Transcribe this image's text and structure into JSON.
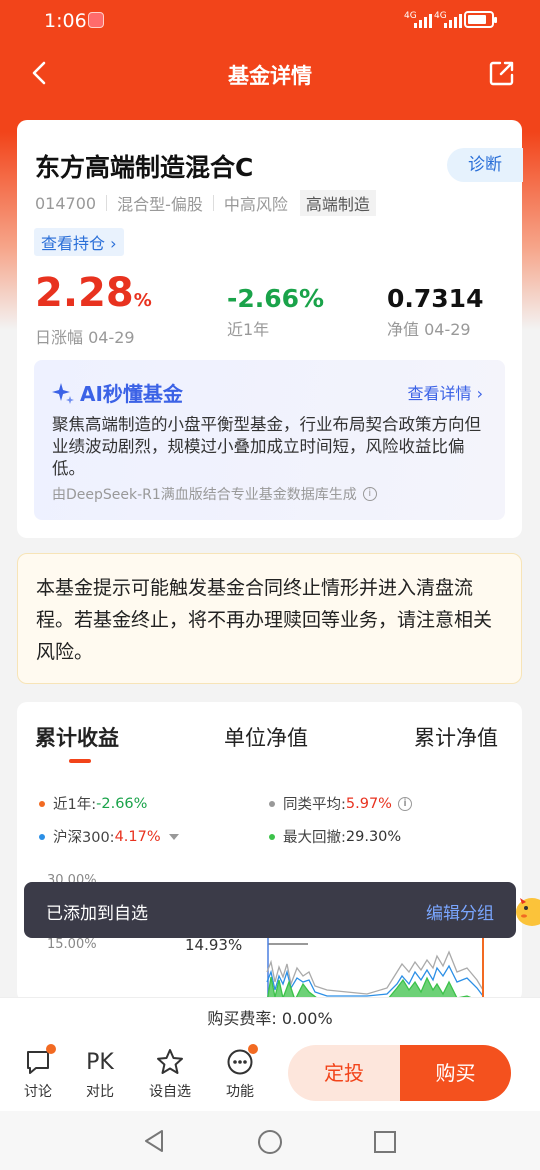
{
  "status": {
    "time": "1:06",
    "net1": "4G",
    "net2": "4G"
  },
  "nav": {
    "title": "基金详情"
  },
  "fund": {
    "name": "东方高端制造混合C",
    "code": "014700",
    "type": "混合型-偏股",
    "risk": "中高风险",
    "theme": "高端制造",
    "diagnose": "诊断",
    "holdings": "查看持仓 ›",
    "daily_change": "2.28",
    "daily_unit": "%",
    "daily_label": "日涨幅 04-29",
    "year_return": "-2.66%",
    "year_label": "近1年",
    "nav_value": "0.7314",
    "nav_label": "净值 04-29"
  },
  "ai": {
    "title": "AI秒懂基金",
    "more": "查看详情 ›",
    "text": "聚焦高端制造的小盘平衡型基金，行业布局契合政策方向但业绩波动剧烈，规模过小叠加成立时间短，风险收益比偏低。",
    "source": "由DeepSeek-R1满血版结合专业基金数据库生成"
  },
  "warning": "本基金提示可能触发基金合同终止情形并进入清盘流程。若基金终止，将不再办理赎回等业务，请注意相关风险。",
  "chart": {
    "tabs": [
      "累计收益",
      "单位净值",
      "累计净值"
    ],
    "legend": [
      {
        "label": "近1年:",
        "value": "-2.66%",
        "color": "#f26a22",
        "value_color": "#1aa34a"
      },
      {
        "label": "同类平均:",
        "value": "5.97%",
        "color": "#999999",
        "value_color": "#e8321f"
      },
      {
        "label": "沪深300:",
        "value": "4.17%",
        "color": "#2b8fe6",
        "value_color": "#e8321f"
      },
      {
        "label": "最大回撤:",
        "value": "29.30%",
        "color": "#3cc24a",
        "value_color": "#333333"
      }
    ],
    "ytick_top": "30.00%",
    "ytick_mid": "15.00%",
    "peak_label": "14.93%"
  },
  "toast": {
    "message": "已添加到自选",
    "action": "编辑分组"
  },
  "fee": "购买费率: 0.00%",
  "toolbar": {
    "discuss": "讨论",
    "compare": "对比",
    "compare_icon_text": "PK",
    "watch": "设自选",
    "features": "功能",
    "auto_invest": "定投",
    "buy": "购买"
  }
}
